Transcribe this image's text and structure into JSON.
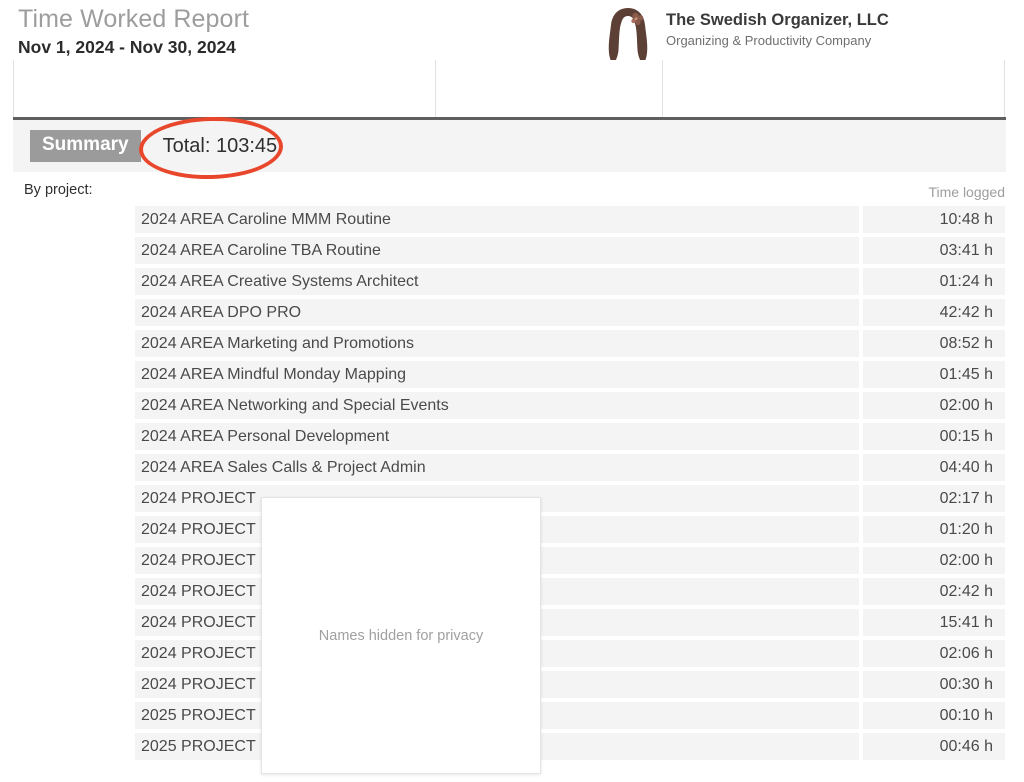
{
  "header": {
    "report_title": "Time Worked Report",
    "date_range": "Nov 1, 2024 - Nov 30, 2024",
    "brand_name": "The Swedish Organizer, LLC",
    "brand_tagline": "Organizing & Productivity Company",
    "logo_icon": "woman-silhouette-logo"
  },
  "summary": {
    "tab_label": "Summary",
    "total_label": "Total: 103:45",
    "annotation_color": "#e8472c"
  },
  "body": {
    "group_label": "By project:",
    "time_column_header": "Time logged",
    "privacy_notice": "Names hidden for privacy"
  },
  "rows": [
    {
      "name": "2024 AREA Caroline MMM Routine",
      "time": "10:48 h"
    },
    {
      "name": "2024 AREA Caroline TBA Routine",
      "time": "03:41 h"
    },
    {
      "name": "2024 AREA Creative Systems Architect",
      "time": "01:24 h"
    },
    {
      "name": "2024 AREA DPO PRO",
      "time": "42:42 h"
    },
    {
      "name": "2024 AREA Marketing and Promotions",
      "time": "08:52 h"
    },
    {
      "name": "2024 AREA Mindful Monday Mapping",
      "time": "01:45 h"
    },
    {
      "name": "2024 AREA Networking and Special Events",
      "time": "02:00 h"
    },
    {
      "name": "2024 AREA Personal Development",
      "time": "00:15 h"
    },
    {
      "name": "2024 AREA Sales Calls & Project Admin",
      "time": "04:40 h"
    },
    {
      "name": "2024 PROJECT",
      "time": "02:17 h"
    },
    {
      "name": "2024 PROJECT",
      "time": "01:20 h"
    },
    {
      "name": "2024 PROJECT",
      "time": "02:00 h"
    },
    {
      "name": "2024 PROJECT",
      "time": "02:42 h"
    },
    {
      "name": "2024 PROJECT",
      "time": "15:41 h"
    },
    {
      "name": "2024 PROJECT",
      "time": "02:06 h"
    },
    {
      "name": "2024 PROJECT",
      "time": "00:30 h"
    },
    {
      "name": "2025 PROJECT",
      "time": "00:10 h"
    },
    {
      "name": "2025 PROJECT",
      "time": "00:46 h"
    }
  ]
}
